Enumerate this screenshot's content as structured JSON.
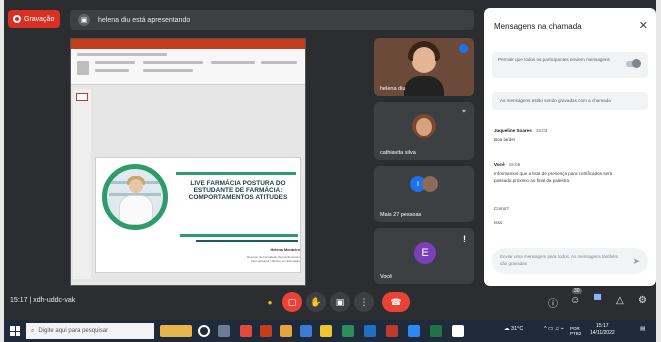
{
  "recording": {
    "label": "Gravação"
  },
  "presenting": {
    "text": "helena diu está apresentando"
  },
  "slide": {
    "title": "LIVE FARMÁCIA POSTURA DO ESTUDANTE DE FARMÁCIA: COMPORTAMENTOS ATITUDES",
    "presenter": "Helena Monteiro",
    "presenter_sub": "Docente de Faculdade Pernambucana / Farmacêutica / Mestre em Educação"
  },
  "participants": [
    {
      "name": "helena diu"
    },
    {
      "name": "cathiavita silva"
    },
    {
      "name": "Mais 27 pessoas"
    },
    {
      "name": "Você",
      "initial": "E"
    }
  ],
  "chat": {
    "title": "Mensagens na chamada",
    "permission": "Permitir que todos os participantes enviem mensagens",
    "saved_note": "As mensagens estão sendo gravadas com a chamada",
    "messages": [
      {
        "sender": "Jaqueline Soares",
        "time": "15:03",
        "lines": [
          "Boa tarde!"
        ]
      },
      {
        "sender": "Você",
        "time": "15:09",
        "lines": [
          "Informamos que a lista de presença para certificados será passada próximo ao final da palestra.",
          "Como?",
          "Isso"
        ]
      }
    ],
    "input_placeholder": "Enviar uma mensagem para todos. As mensagens também são gravadas"
  },
  "callbar": {
    "time": "15:17",
    "meeting_code": "xdh-uddc-vak",
    "people_count": "30"
  },
  "taskbar": {
    "search_placeholder": "Digite aqui para pesquisar",
    "weather": "31°C",
    "language": "POR PTB2",
    "time": "15:17",
    "date": "14/11/2022"
  },
  "colors": {
    "accent_green": "#2e9c6a",
    "record_red": "#d93025",
    "meet_dark": "#2b2d31",
    "chat_bg": "#ffffff"
  }
}
